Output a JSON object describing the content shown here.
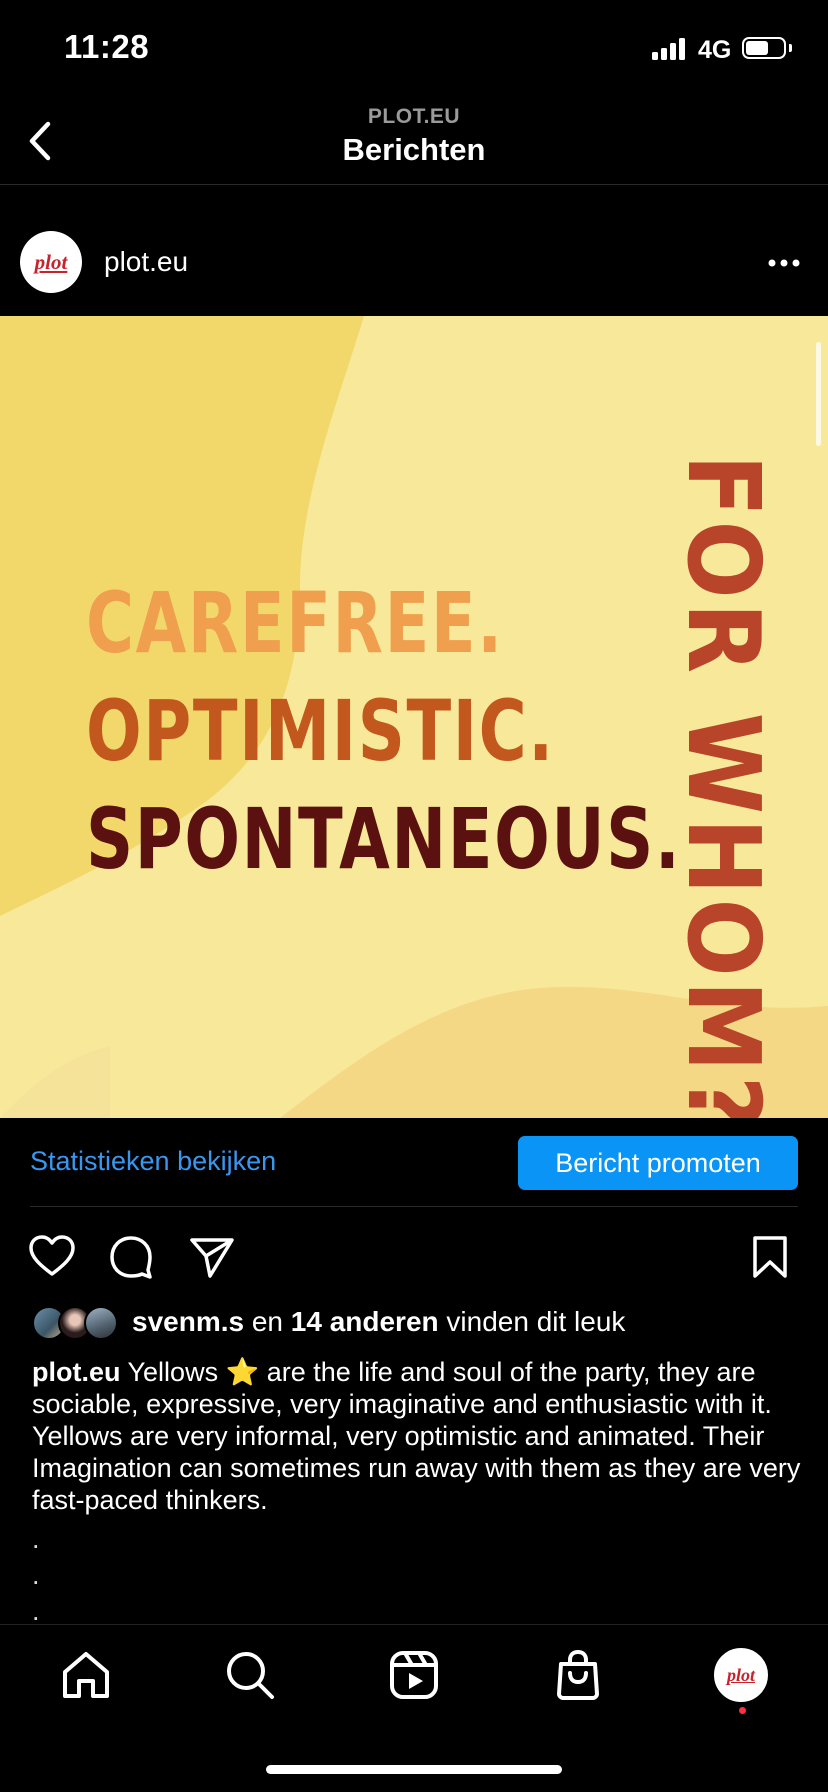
{
  "status_bar": {
    "time": "11:28",
    "network": "4G",
    "battery_level": 0.6
  },
  "header": {
    "subtitle": "PLOT.EU",
    "title": "Berichten"
  },
  "post": {
    "account_logo": "plot",
    "username": "plot.eu",
    "image": {
      "lines": [
        "CAREFREE.",
        "OPTIMISTIC.",
        "SPONTANEOUS."
      ],
      "vertical_text": "FOR WHOM?",
      "colors": {
        "line1": "#ef9f4e",
        "line2": "#c2581e",
        "line3": "#5c1111",
        "vertical": "#b8452a",
        "bg_light": "#f8e89a",
        "bg_dark": "#f1d46a"
      }
    },
    "stats_link": "Statistieken bekijken",
    "promote_button": "Bericht promoten",
    "likes": {
      "user": "svenm.s",
      "connector": " en ",
      "others": "14 anderen",
      "suffix": " vinden dit leuk"
    },
    "caption": {
      "username": "plot.eu",
      "text_before_emoji": " Yellows ",
      "emoji": "⭐",
      "text_after_emoji": " are the life and soul of the party, they are sociable, expressive, very imaginative and enthusiastic with it. Yellows are very informal, very optimistic and animated. Their Imagination can sometimes run away with them as they are very fast-paced thinkers."
    },
    "dots": [
      ".",
      ".",
      "."
    ]
  },
  "bottom_nav": {
    "items": [
      "home-icon",
      "search-icon",
      "reels-icon",
      "shop-icon",
      "profile-avatar"
    ],
    "profile_logo": "plot"
  }
}
